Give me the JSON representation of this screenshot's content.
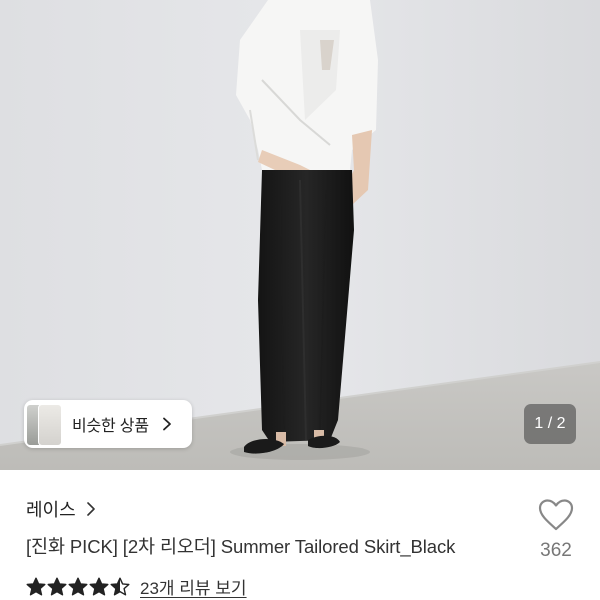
{
  "photo": {
    "similar_button": {
      "label": "비슷한 상품",
      "chevron_icon": "chevron-right-icon"
    },
    "pager": {
      "text": "1 / 2"
    }
  },
  "product": {
    "brand": "레이스",
    "brand_chevron_icon": "chevron-right-icon",
    "title": "[진화 PICK] [2차 리오더] Summer Tailored Skirt_Black",
    "like": {
      "icon": "heart-outline-icon",
      "count": "362"
    },
    "rating": {
      "value": 4.5,
      "max": 5,
      "star_color": "#222222"
    },
    "reviews_link": "23개 리뷰 보기"
  }
}
